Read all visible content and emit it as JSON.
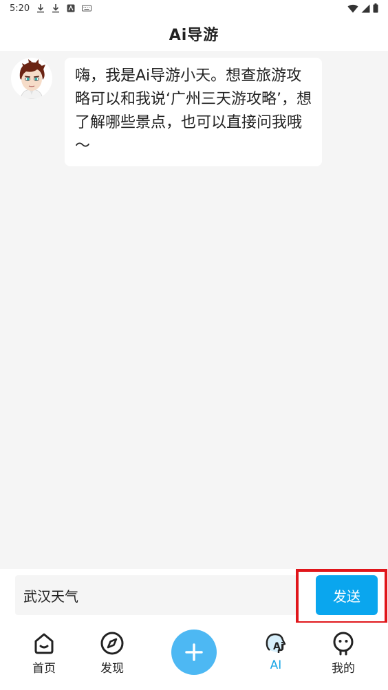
{
  "status_bar": {
    "time": "5:20"
  },
  "app_bar": {
    "title": "Ai导游"
  },
  "chat": {
    "messages": [
      {
        "sender": "bot",
        "text": "嗨，我是Ai导游小天。想查旅游攻略可以和我说‘广州三天游攻略’，想了解哪些景点，也可以直接问我哦～"
      }
    ]
  },
  "input_bar": {
    "value": "武汉天气",
    "send_label": "发送"
  },
  "tab_bar": {
    "items": [
      {
        "label": "首页",
        "icon": "home-icon"
      },
      {
        "label": "发现",
        "icon": "compass-icon"
      },
      {
        "label": "",
        "icon": "plus-icon"
      },
      {
        "label": "AI",
        "icon": "ai-head-icon",
        "active": true
      },
      {
        "label": "我的",
        "icon": "profile-icon"
      }
    ]
  },
  "colors": {
    "accent": "#0aa6ee",
    "fab": "#4db8f3",
    "active_tab": "#1aa6e6",
    "highlight": "#e0161b"
  }
}
